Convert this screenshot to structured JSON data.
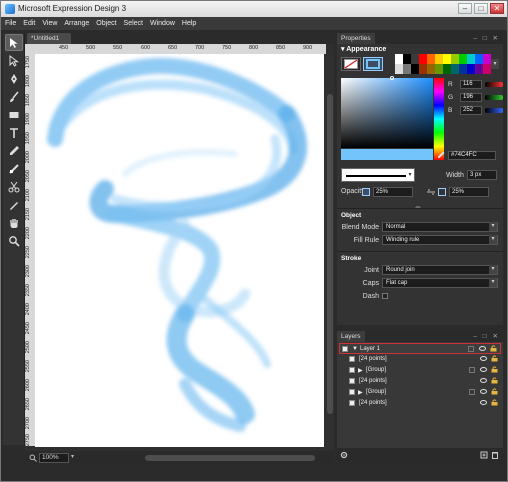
{
  "window": {
    "title": "Microsoft Expression Design 3"
  },
  "menu": [
    "File",
    "Edit",
    "View",
    "Arrange",
    "Object",
    "Select",
    "Window",
    "Help"
  ],
  "tools": [
    "selection-arrow-icon",
    "direct-select-icon",
    "pen-icon",
    "brush-icon",
    "rectangle-icon",
    "text-icon",
    "eyedropper-icon",
    "gradient-icon",
    "scissors-icon",
    "knife-icon",
    "hand-icon",
    "zoom-icon"
  ],
  "document": {
    "tab": "*Untitled1",
    "ruler_top": [
      "450",
      "500",
      "550",
      "600",
      "650",
      "700",
      "750",
      "800",
      "850",
      "900"
    ],
    "ruler_left": [
      "1750",
      "1800",
      "1850",
      "1900",
      "1950",
      "2000",
      "2050",
      "2100",
      "2150",
      "2200",
      "2250",
      "2300",
      "2350",
      "2400",
      "2450",
      "2500",
      "2550",
      "2600",
      "2650",
      "2700",
      "2750"
    ],
    "zoom": "100%"
  },
  "properties": {
    "tab": "Properties",
    "appearance_title": "Appearance",
    "swatch_colors": [
      "#ffffff",
      "#000000",
      "#3a3a3a",
      "#ff0000",
      "#ff6600",
      "#ffcc00",
      "#ffff00",
      "#99cc00",
      "#00cc00",
      "#00cccc",
      "#0066ff",
      "#cc00cc",
      "#dddddd",
      "#777777",
      "#000000",
      "#993300",
      "#996600",
      "#669900",
      "#006600",
      "#006666",
      "#003399",
      "#0000cc",
      "#660099",
      "#cc0066"
    ],
    "rgb": [
      {
        "label": "R",
        "value": "116",
        "color": "#c84040"
      },
      {
        "label": "G",
        "value": "196",
        "color": "#40a040"
      },
      {
        "label": "B",
        "value": "252",
        "color": "#4060d8"
      }
    ],
    "hex": "#74C4FC",
    "current_color": "#74c4fc",
    "width_label": "Width",
    "width_value": "3 px",
    "opacity_label": "Opacity",
    "opacity_fill": "25%",
    "opacity_stroke": "25%",
    "object_title": "Object",
    "blend_mode_label": "Blend Mode",
    "blend_mode_value": "Normal",
    "fill_rule_label": "Fill Rule",
    "fill_rule_value": "Winding rule",
    "stroke_title": "Stroke",
    "joint_label": "Joint",
    "joint_value": "Round join",
    "caps_label": "Caps",
    "caps_value": "Flat cap",
    "dash_label": "Dash"
  },
  "layers": {
    "tab": "Layers",
    "items": [
      {
        "label": "Layer 1",
        "indent": 0,
        "expander": "▼"
      },
      {
        "label": "[24 points]",
        "indent": 1,
        "expander": ""
      },
      {
        "label": "[Group]",
        "indent": 1,
        "expander": "▶"
      },
      {
        "label": "[24 points]",
        "indent": 1,
        "expander": ""
      },
      {
        "label": "[Group]",
        "indent": 1,
        "expander": "▶"
      },
      {
        "label": "[24 points]",
        "indent": 1,
        "expander": ""
      }
    ]
  }
}
